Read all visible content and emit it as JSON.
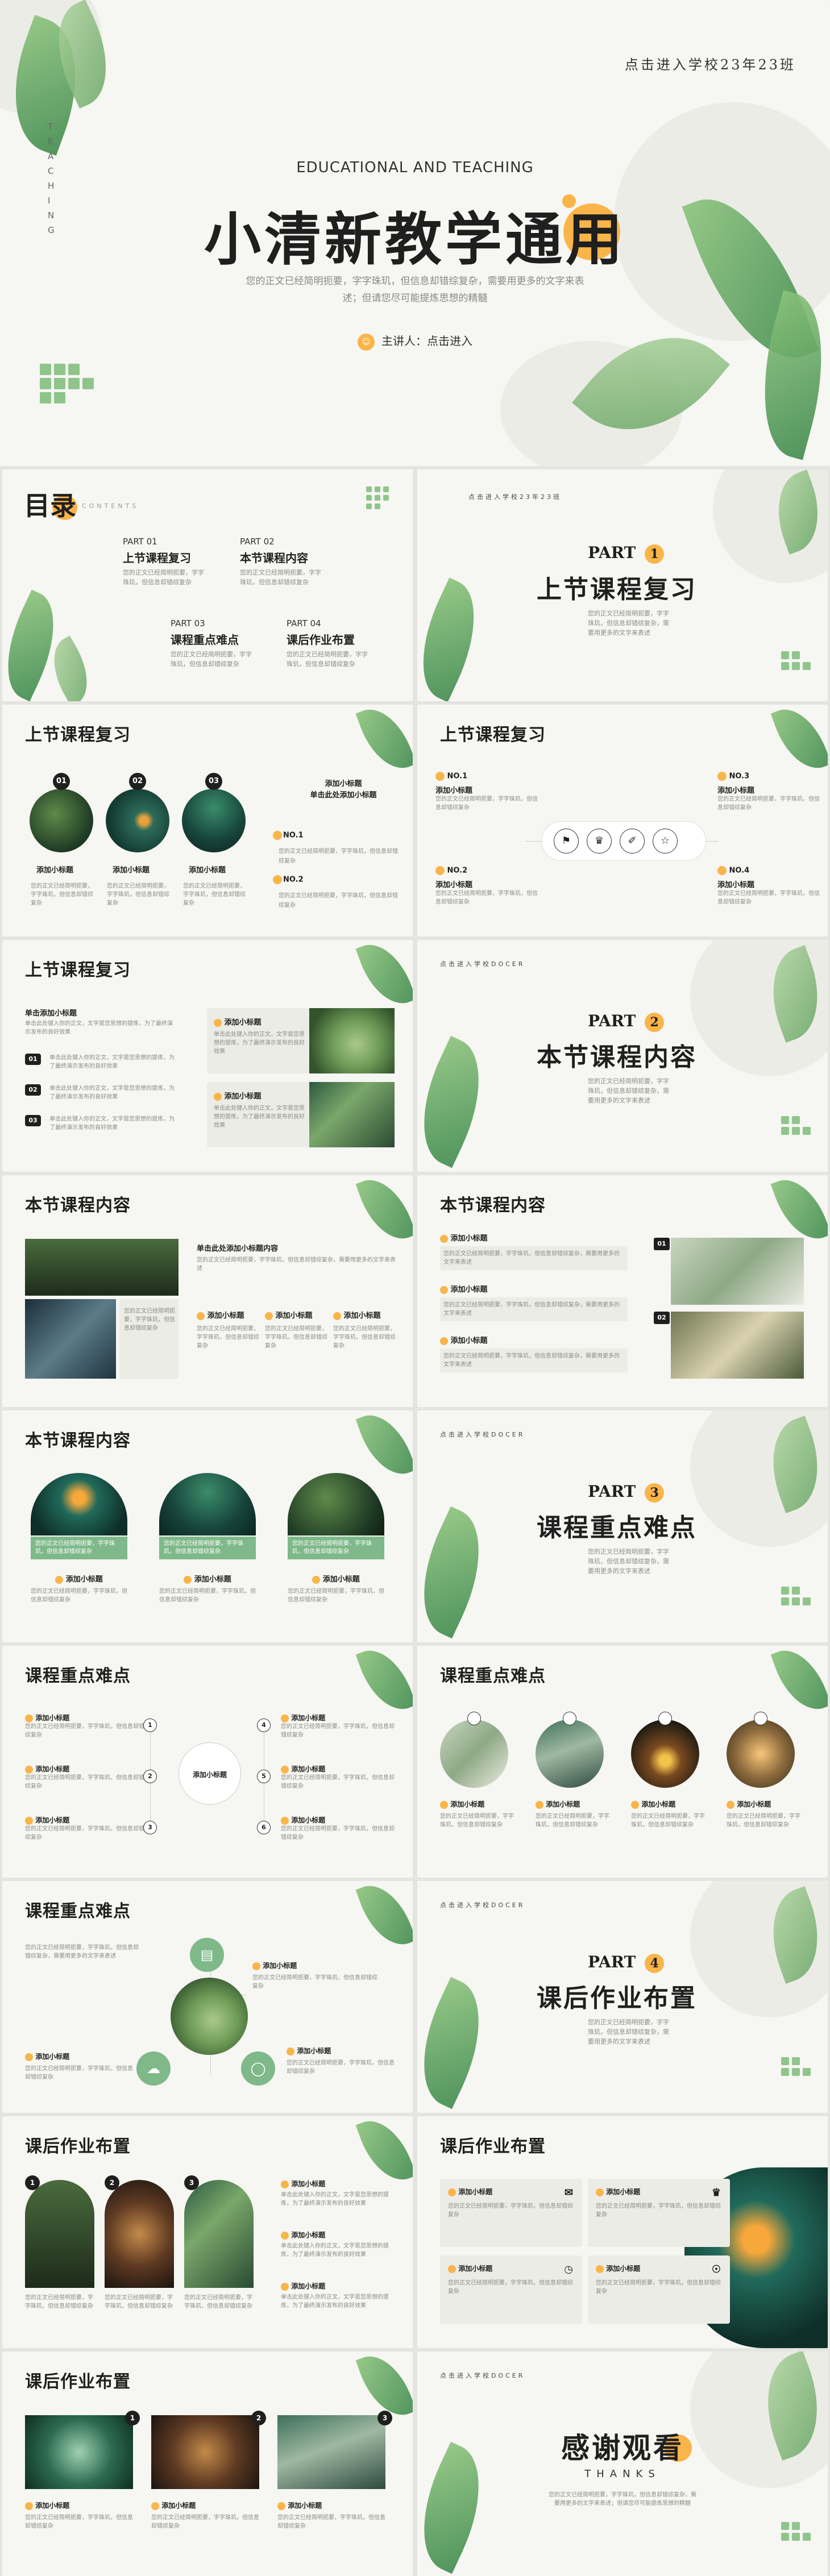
{
  "colors": {
    "accent": "#f9b54a",
    "green": "#7fb98a",
    "dark": "#1f1f1f",
    "bg": "#f6f6f2"
  },
  "cover": {
    "class_text": "点击进入学校23年23班",
    "vertical": "T E A C H I N G",
    "en_title": "EDUCATIONAL AND TEACHING",
    "title_main": "小清新教学通",
    "title_hl": "用",
    "desc": "您的正文已经简明扼要，字字珠玑，但信息却错综复杂，需要用更多的文字来表述；但请您尽可能提炼思想的精髓",
    "speaker": "主讲人：点击进入"
  },
  "toc": {
    "title_a": "目",
    "title_b": "录",
    "contents_en": "CONTENTS",
    "items": [
      {
        "part": "PART 01",
        "name": "上节课程复习",
        "desc": "您的正文已经简明扼要，字字珠玑，但信息却错综复杂"
      },
      {
        "part": "PART 02",
        "name": "本节课程内容",
        "desc": "您的正文已经简明扼要，字字珠玑，但信息却错综复杂"
      },
      {
        "part": "PART 03",
        "name": "课程重点难点",
        "desc": "您的正文已经简明扼要，字字珠玑，但信息却错综复杂"
      },
      {
        "part": "PART 04",
        "name": "课后作业布置",
        "desc": "您的正文已经简明扼要，字字珠玑，但信息却错综复杂"
      }
    ]
  },
  "sections": [
    {
      "top": "点击进入学校23年23班",
      "part": "PART",
      "n": "1",
      "title": "上节课程复习",
      "desc": "您的正文已经简明扼要，字字珠玑，但信息却错综复杂，需要用更多的文字来表述"
    },
    {
      "top": "点击进入学校DOCER",
      "part": "PART",
      "n": "2",
      "title": "本节课程内容",
      "desc": "您的正文已经简明扼要，字字珠玑，但信息却错综复杂，需要用更多的文字来表述"
    },
    {
      "top": "点击进入学校DOCER",
      "part": "PART",
      "n": "3",
      "title": "课程重点难点",
      "desc": "您的正文已经简明扼要，字字珠玑，但信息却错综复杂，需要用更多的文字来表述"
    },
    {
      "top": "点击进入学校DOCER",
      "part": "PART",
      "n": "4",
      "title": "课后作业布置",
      "desc": "您的正文已经简明扼要，字字珠玑，但信息却错综复杂，需要用更多的文字来表述"
    }
  ],
  "common": {
    "sub": "添加小标题",
    "body": "您的正文已经简明扼要，字字珠玑，但信息却错综复杂，需要用更多的文字来表述",
    "body_short": "您的正文已经简明扼要，字字珠玑，但信息却错综复杂",
    "body2": "单击此处键入你的正文，文字是您思想的提炼，为了最终演示发布的良好效果"
  },
  "review1": {
    "title": "上节课程复习",
    "nums": [
      "01",
      "02",
      "03"
    ],
    "right_title": "添加小标题\n单击此处添加小标题",
    "no1": "NO.1",
    "no2": "NO.2"
  },
  "review2": {
    "title": "上节课程复习",
    "labels": [
      "NO.1",
      "NO.2",
      "NO.3",
      "NO.4"
    ],
    "icons": [
      "⚑",
      "♛",
      "✐",
      "☆"
    ]
  },
  "review3": {
    "title": "上节课程复习",
    "left_head": "单击添加小标题",
    "nums": [
      "01",
      "02",
      "03"
    ]
  },
  "content1": {
    "title": "本节课程内容",
    "head": "单击此处添加小标题内容"
  },
  "content2": {
    "title": "本节课程内容",
    "nums": [
      "01",
      "02"
    ]
  },
  "content3": {
    "title": "本节课程内容"
  },
  "key1": {
    "title": "课程重点难点",
    "center": "添加小标题",
    "nums": [
      "1",
      "2",
      "3",
      "4",
      "5",
      "6"
    ]
  },
  "key2": {
    "title": "课程重点难点"
  },
  "key3": {
    "title": "课程重点难点"
  },
  "hw1": {
    "title": "课后作业布置",
    "nums": [
      "1",
      "2",
      "3"
    ]
  },
  "hw2": {
    "title": "课后作业布置"
  },
  "hw3": {
    "title": "课后作业布置",
    "nums": [
      "1",
      "2",
      "3"
    ]
  },
  "thanks": {
    "top": "点击进入学校DOCER",
    "title": "感谢观看",
    "en": "THANKS",
    "desc": "您的正文已经简明扼要，字字珠玑，但信息却错综复杂，需要用更多的文字来表述；但请您尽可能提炼思想的精髓"
  }
}
